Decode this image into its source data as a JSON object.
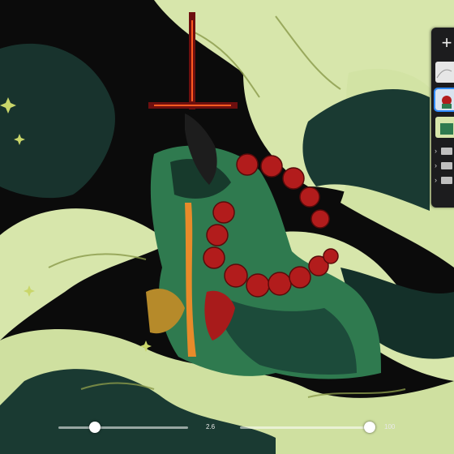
{
  "brush_size": {
    "value_label": "2.6",
    "position": 0.28
  },
  "opacity": {
    "value_label": "100",
    "position": 1.0
  },
  "layers_panel": {
    "add_label": "+"
  },
  "colors": {
    "background": "#0b0b0b",
    "pale_green": "#d9e8ae",
    "dark_teal": "#1c3a33",
    "robe_green": "#2f7a4f",
    "bead_red": "#b21c1c",
    "selection_blue": "#2f8bff"
  },
  "icons": [
    "plus-icon",
    "chevron-right-icon",
    "folder-icon"
  ]
}
